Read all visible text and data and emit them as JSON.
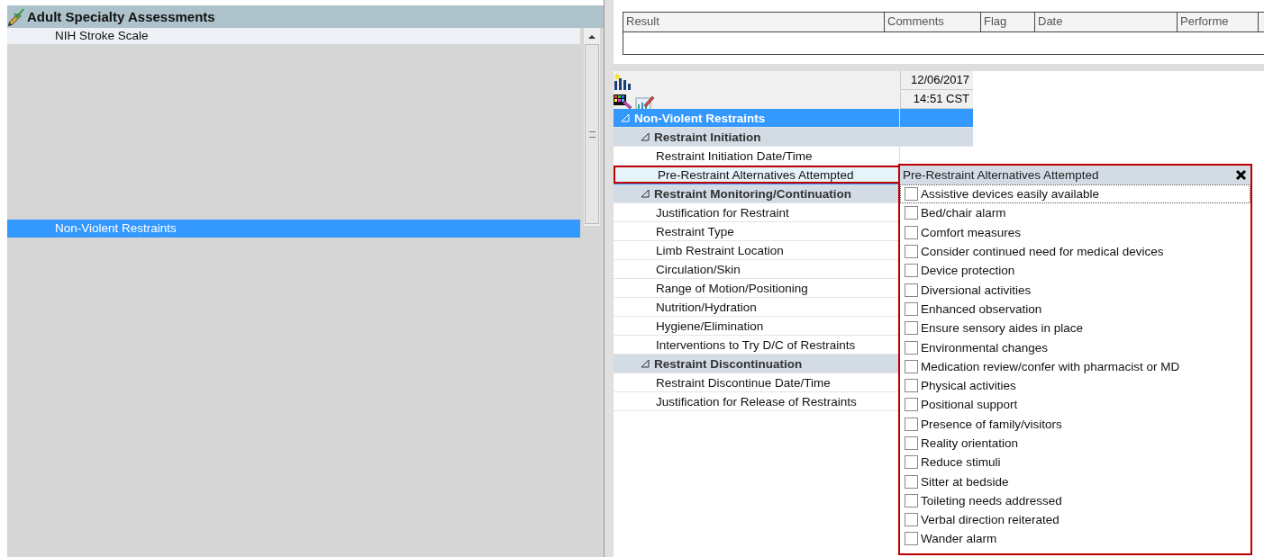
{
  "left_panel": {
    "title": "Adult Specialty Assessments",
    "items": [
      {
        "label": "NIH Stroke Scale",
        "selected": false
      },
      {
        "label": "Non-Violent Restraints",
        "selected": true
      }
    ]
  },
  "results_table": {
    "columns": [
      "Result",
      "Comments",
      "Flag",
      "Date",
      "Performe"
    ]
  },
  "flowsheet": {
    "date": "12/06/2017",
    "time": "14:51 CST",
    "rows": [
      {
        "kind": "section",
        "label": "Non-Violent Restraints",
        "expanded": true
      },
      {
        "kind": "group",
        "label": "Restraint Initiation",
        "expanded": true
      },
      {
        "kind": "item",
        "label": "Restraint Initiation Date/Time",
        "selected": false
      },
      {
        "kind": "item",
        "label": "Pre-Restraint Alternatives Attempted",
        "selected": true
      },
      {
        "kind": "group",
        "label": "Restraint Monitoring/Continuation",
        "expanded": true
      },
      {
        "kind": "item",
        "label": "Justification for Restraint",
        "selected": false
      },
      {
        "kind": "item",
        "label": "Restraint Type",
        "selected": false
      },
      {
        "kind": "item",
        "label": "Limb Restraint Location",
        "selected": false
      },
      {
        "kind": "item",
        "label": "Circulation/Skin",
        "selected": false
      },
      {
        "kind": "item",
        "label": "Range of Motion/Positioning",
        "selected": false
      },
      {
        "kind": "item",
        "label": "Nutrition/Hydration",
        "selected": false
      },
      {
        "kind": "item",
        "label": "Hygiene/Elimination",
        "selected": false
      },
      {
        "kind": "item",
        "label": "Interventions to Try D/C of Restraints",
        "selected": false
      },
      {
        "kind": "group",
        "label": "Restraint Discontinuation",
        "expanded": true
      },
      {
        "kind": "item",
        "label": "Restraint Discontinue Date/Time",
        "selected": false
      },
      {
        "kind": "item",
        "label": "Justification for Release of Restraints",
        "selected": false
      }
    ]
  },
  "popup": {
    "title": "Pre-Restraint Alternatives Attempted",
    "options": [
      {
        "label": "Assistive devices easily available",
        "checked": false
      },
      {
        "label": "Bed/chair alarm",
        "checked": false
      },
      {
        "label": "Comfort measures",
        "checked": false
      },
      {
        "label": "Consider continued need for medical devices",
        "checked": false
      },
      {
        "label": "Device protection",
        "checked": false
      },
      {
        "label": "Diversional activities",
        "checked": false
      },
      {
        "label": "Enhanced observation",
        "checked": false
      },
      {
        "label": "Ensure sensory aides in place",
        "checked": false
      },
      {
        "label": "Environmental changes",
        "checked": false
      },
      {
        "label": "Medication review/confer with pharmacist or MD",
        "checked": false
      },
      {
        "label": "Physical activities",
        "checked": false
      },
      {
        "label": "Positional support",
        "checked": false
      },
      {
        "label": "Presence of family/visitors",
        "checked": false
      },
      {
        "label": "Reality orientation",
        "checked": false
      },
      {
        "label": "Reduce stimuli",
        "checked": false
      },
      {
        "label": "Sitter at bedside",
        "checked": false
      },
      {
        "label": "Toileting needs addressed",
        "checked": false
      },
      {
        "label": "Verbal direction reiterated",
        "checked": false
      },
      {
        "label": "Wander alarm",
        "checked": false
      }
    ]
  }
}
